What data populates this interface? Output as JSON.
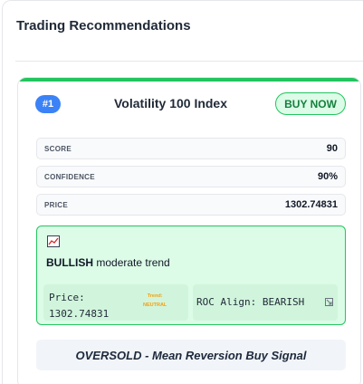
{
  "panel": {
    "title": "Trading Recommendations"
  },
  "card": {
    "rank": "#1",
    "symbol": "Volatility 100 Index",
    "action_label": "BUY NOW",
    "metrics": [
      {
        "label": "SCORE",
        "value": "90"
      },
      {
        "label": "CONFIDENCE",
        "value": "90%"
      },
      {
        "label": "PRICE",
        "value": "1302.74831"
      }
    ],
    "trend": {
      "icon": "chart-trend-icon",
      "direction": "BULLISH",
      "strength_text": "moderate trend",
      "price_label": "Price:",
      "price_value": "1302.74831",
      "mini_trend_label": "Trend:",
      "mini_trend_value": "NEUTRAL",
      "roc_text": "ROC Align: BEARISH",
      "roc_icon": "roc-signal-icon"
    },
    "signal_text": "OVERSOLD - Mean Reversion Buy Signal"
  },
  "colors": {
    "accent_green": "#22c55e",
    "rank_blue": "#3b82f6",
    "trend_bg": "#dcfce7",
    "neutral_orange": "#f59e0b"
  }
}
